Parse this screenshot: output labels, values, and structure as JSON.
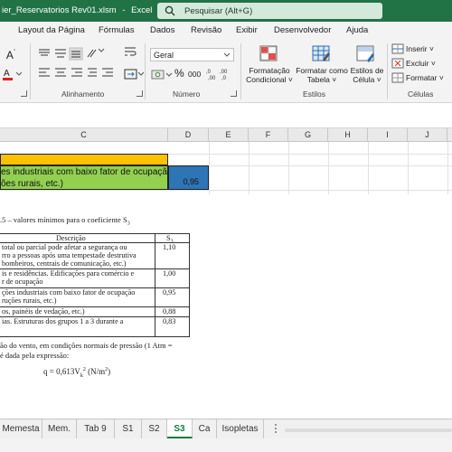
{
  "titlebar": {
    "filename": "ier_Reservatorios Rev01.xlsm",
    "separator": "-",
    "app": "Excel",
    "search_placeholder": "Pesquisar (Alt+G)"
  },
  "ribbon_tabs": [
    "Layout da Página",
    "Fórmulas",
    "Dados",
    "Revisão",
    "Exibir",
    "Desenvolvedor",
    "Ajuda"
  ],
  "ribbon": {
    "groups": {
      "alignment": "Alinhamento",
      "number": "Número",
      "styles": "Estilos",
      "cells": "Células"
    },
    "number_format": "Geral",
    "percent_symbol": "%",
    "thousands_symbol": "000",
    "styles_buttons": {
      "conditional": [
        "Formatação",
        "Condicional"
      ],
      "table": [
        "Formatar como",
        "Tabela"
      ],
      "cell_styles": [
        "Estilos de",
        "Célula"
      ]
    },
    "cells_buttons": {
      "insert": "Inserir",
      "delete": "Excluir",
      "format": "Formatar"
    }
  },
  "columns": [
    "C",
    "D",
    "E",
    "F",
    "G",
    "H",
    "I",
    "J"
  ],
  "sheet": {
    "green_line1": "es industriais com baixo fator de ocupação",
    "green_line2": "ões rurais, etc.)",
    "blue_value": "0,95",
    "table_caption_prefix": ".5 – valores mínimos para o coeficiente S",
    "table_caption_sub": "3",
    "table_header_desc": "Descrição",
    "table_header_s": "S",
    "table_header_s_sub": "3",
    "rows": [
      {
        "lines": [
          "total ou parcial pode afetar a segurança ou",
          "rro a pessoas após uma tempestade destrutiva",
          "bombeiros, centrais de comunicação, etc.)"
        ],
        "value": "1,10"
      },
      {
        "lines": [
          "is e residências. Edificações para comércio e",
          "r de ocupação"
        ],
        "value": "1,00"
      },
      {
        "lines": [
          "ções industriais com baixo fator de ocupação",
          "ruções rurais, etc.)"
        ],
        "value": "0,95"
      },
      {
        "lines": [
          "os, painéis de vedação, etc.)"
        ],
        "value": "0,88"
      },
      {
        "lines": [
          "ias. Estruturas dos grupos 1 a 3 durante a"
        ],
        "value": "0,83"
      }
    ],
    "para_line1": "ão do vento, em condições normais de pressão (1 Atm =",
    "para_line2": "é dada pela expressão:",
    "formula_prefix": "q = 0,613V",
    "formula_sub": "k",
    "formula_sup": "2",
    "formula_suffix": " (N/m",
    "formula_sup2": "2",
    "formula_end": ")"
  },
  "sheet_tabs": [
    "Memesta",
    "Mem.",
    "Tab 9",
    "S1",
    "S2",
    "S3",
    "Ca",
    "Isopletas"
  ],
  "active_sheet": "S3",
  "colors": {
    "excel_green": "#217346",
    "orange_fill": "#ffc000",
    "green_fill": "#92d050",
    "blue_fill": "#2e75b6"
  }
}
